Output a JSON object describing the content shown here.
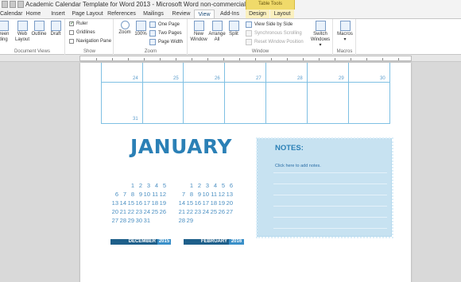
{
  "titlebar": {
    "title": "Academic Calendar Template for Word 2013 - Microsoft Word non-commercial...",
    "context_tab_group": "Table Tools"
  },
  "tabs": [
    {
      "label": "Calendar"
    },
    {
      "label": "Home"
    },
    {
      "label": "Insert"
    },
    {
      "label": "Page Layout"
    },
    {
      "label": "References"
    },
    {
      "label": "Mailings"
    },
    {
      "label": "Review"
    },
    {
      "label": "View",
      "active": true
    },
    {
      "label": "Add-Ins"
    },
    {
      "label": "Design"
    },
    {
      "label": "Layout"
    }
  ],
  "ribbon": {
    "document_views": {
      "label": "Document Views",
      "buttons": [
        "creen\nding",
        "Web\nLayout",
        "Outline",
        "Draft"
      ]
    },
    "show": {
      "label": "Show",
      "items": [
        {
          "label": "Ruler",
          "checked": true
        },
        {
          "label": "Gridlines",
          "checked": false
        },
        {
          "label": "Navigation Pane",
          "checked": false
        }
      ]
    },
    "zoom": {
      "label": "Zoom",
      "zoom_button": "Zoom",
      "percent_button": "100%",
      "one_page": "One Page",
      "two_pages": "Two Pages",
      "page_width": "Page Width"
    },
    "window": {
      "label": "Window",
      "new_window": "New\nWindow",
      "arrange_all": "Arrange\nAll",
      "split": "Split",
      "view_side_by_side": "View Side by Side",
      "synchronous_scrolling": "Synchronous Scrolling",
      "reset_window_position": "Reset Window Position",
      "switch_windows": "Switch\nWindows ▾"
    },
    "macros": {
      "label": "Macros",
      "button": "Macros\n▾"
    }
  },
  "calendar_grid": {
    "row1_days": [
      "24",
      "25",
      "26",
      "27",
      "28",
      "29",
      "30"
    ],
    "row2_days": [
      "31"
    ]
  },
  "month_title": "JANUARY",
  "mini_calendars": [
    {
      "month": "DECEMBER",
      "year": "2015",
      "rows": [
        [
          "",
          "",
          "1",
          "2",
          "3",
          "4",
          "5"
        ],
        [
          "6",
          "7",
          "8",
          "9",
          "10",
          "11",
          "12"
        ],
        [
          "13",
          "14",
          "15",
          "16",
          "17",
          "18",
          "19"
        ],
        [
          "20",
          "21",
          "22",
          "23",
          "24",
          "25",
          "26"
        ],
        [
          "27",
          "28",
          "29",
          "30",
          "31",
          "",
          ""
        ]
      ]
    },
    {
      "month": "FEBRUARY",
      "year": "2016",
      "rows": [
        [
          "",
          "1",
          "2",
          "3",
          "4",
          "5",
          "6"
        ],
        [
          "7",
          "8",
          "9",
          "10",
          "11",
          "12",
          "13"
        ],
        [
          "14",
          "15",
          "16",
          "17",
          "18",
          "19",
          "20"
        ],
        [
          "21",
          "22",
          "23",
          "24",
          "25",
          "26",
          "27"
        ],
        [
          "28",
          "29",
          "",
          "",
          "",
          "",
          ""
        ]
      ]
    }
  ],
  "notes": {
    "title": "NOTES:",
    "hint": "Click here to add notes."
  },
  "colors": {
    "accent_blue": "#2b80b6",
    "notes_fill": "#c7e2f1",
    "context_tab": "#f0da6a"
  }
}
